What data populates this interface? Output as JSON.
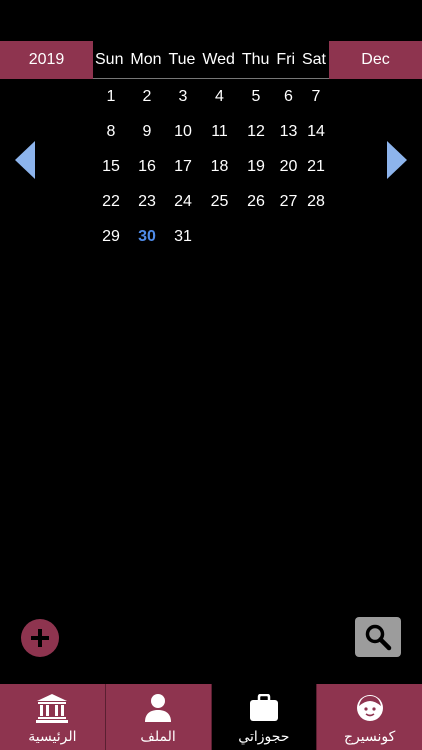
{
  "header": {
    "year": "2019",
    "month": "Dec",
    "weekdays": [
      "Sun",
      "Mon",
      "Tue",
      "Wed",
      "Thu",
      "Fri",
      "Sat"
    ]
  },
  "calendar": {
    "days": [
      "1",
      "2",
      "3",
      "4",
      "5",
      "6",
      "7",
      "8",
      "9",
      "10",
      "11",
      "12",
      "13",
      "14",
      "15",
      "16",
      "17",
      "18",
      "19",
      "20",
      "21",
      "22",
      "23",
      "24",
      "25",
      "26",
      "27",
      "28",
      "29",
      "30",
      "31"
    ],
    "today": "30"
  },
  "controls": {
    "prev_icon": "left-arrow-icon",
    "next_icon": "right-arrow-icon",
    "add_icon": "plus-icon",
    "search_icon": "search-icon"
  },
  "tabbar": {
    "items": [
      {
        "label": "الرئيسية",
        "icon": "bank-icon"
      },
      {
        "label": "الملف",
        "icon": "person-icon"
      },
      {
        "label": "حجوزاتي",
        "icon": "briefcase-icon"
      },
      {
        "label": "كونسيرج",
        "icon": "concierge-icon"
      }
    ],
    "active_index": 2
  },
  "colors": {
    "accent": "#8e344f",
    "today": "#4f8be8",
    "arrow": "#8db4ec",
    "search_bg": "#9c9c9c",
    "background": "#000000"
  }
}
